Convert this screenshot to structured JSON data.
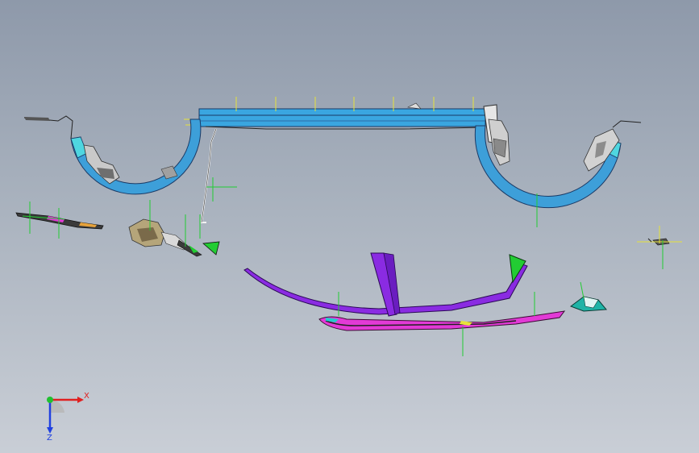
{
  "triad": {
    "x_label": "X",
    "y_label": "Y",
    "z_label": "Z"
  },
  "colors": {
    "background_top": "#8e99aa",
    "background_bottom": "#c9ced6",
    "frame_blue": "#3aa6e0",
    "wheel_arch_blue": "#3d9fd9",
    "wheel_arch_cyan": "#4fd6e0",
    "grille_purple": "#8a2be2",
    "trim_magenta": "#e23ad6",
    "accent_green": "#22cc33",
    "reference_yellow": "#e6e23a",
    "teal_part": "#1fb3a6",
    "axis_x": "#e02020",
    "axis_y": "#20c030",
    "axis_z": "#2040e0"
  }
}
